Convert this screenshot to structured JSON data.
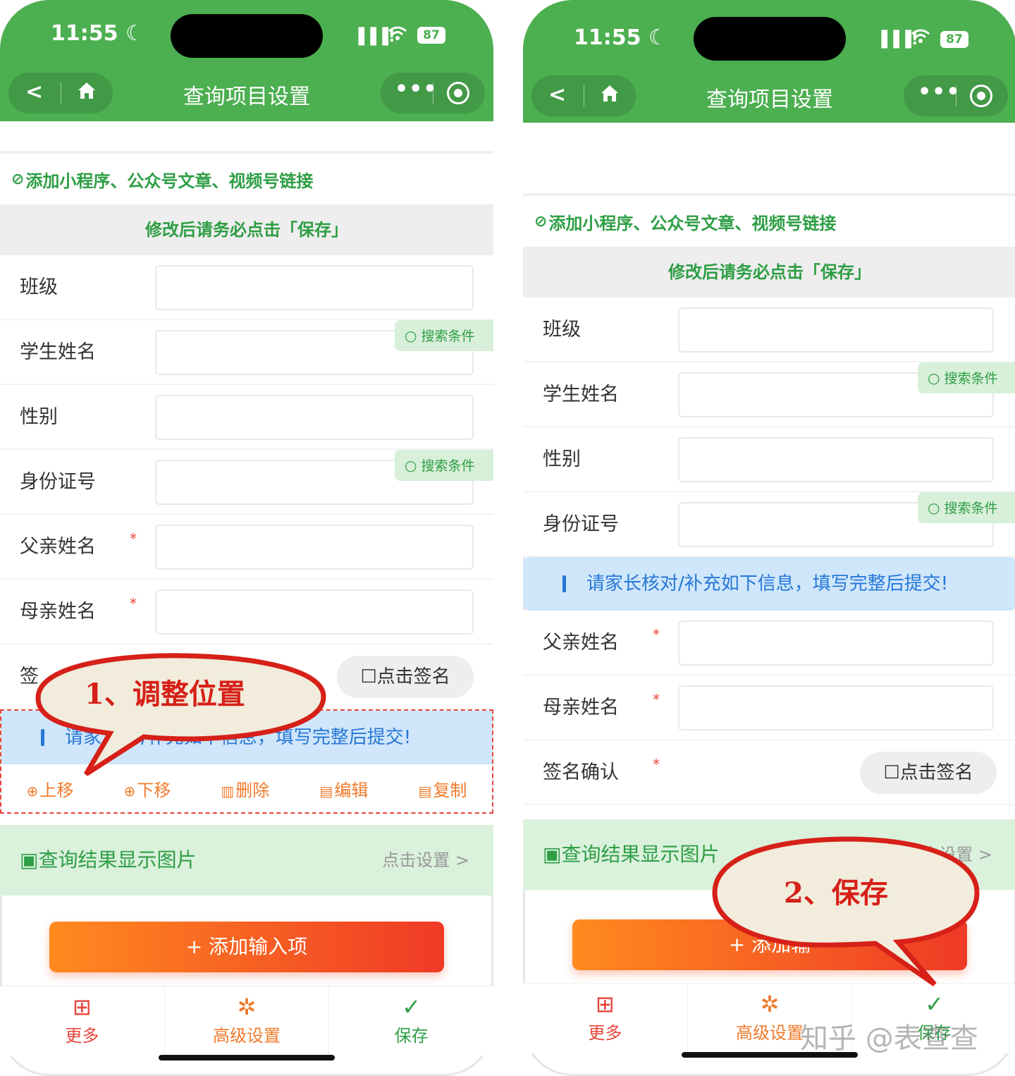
{
  "status_bar": {
    "time": "11:55 ☾",
    "battery": "87",
    "signal": "▐▐▐!",
    "wifi": "◠"
  },
  "nav": {
    "title": "查询项目设置",
    "back": "<",
    "more": "•••"
  },
  "colors": {
    "header_green": "#4caf50",
    "accent_green": "#2e9e45",
    "orange": "#f07a2b",
    "red": "#e8453c",
    "blue": "#2677d6"
  },
  "link_row": {
    "icon": "⊘",
    "label": "添加小程序、公众号文章、视频号链接"
  },
  "notice": "修改后请务必点击「保存」",
  "fields": {
    "class": "班级",
    "student_name": "学生姓名",
    "gender": "性别",
    "id_number": "身份证号",
    "father_name": "父亲姓名",
    "mother_name": "母亲姓名",
    "signature": "签名确认",
    "signature_left_visible": "签",
    "required_mark": "*"
  },
  "search_tag": {
    "icon": "○",
    "label": "搜索条件"
  },
  "sign_button": "☐点击签名",
  "banner": "请家长核对/补充如下信息，填写完整后提交!",
  "banner_left_visible": {
    "a": "请家",
    "b": "对/补充如下信息，填写完整后提交!"
  },
  "ops": [
    {
      "icon": "⊕",
      "label": "上移"
    },
    {
      "icon": "⊕",
      "label": "下移"
    },
    {
      "icon": "▥",
      "label": "删除"
    },
    {
      "icon": "▤",
      "label": "编辑"
    },
    {
      "icon": "▤",
      "label": "复制"
    }
  ],
  "result_image": {
    "icon": "▣",
    "label": "查询结果显示图片",
    "link": "点击设置 >",
    "link_partial": "击设置 >"
  },
  "add_button": "+ 添加输入项",
  "add_button_partial": "+ 添加输",
  "tabs": [
    {
      "icon": "⊞",
      "label": "更多",
      "color": "#e8453c"
    },
    {
      "icon": "✲",
      "label": "高级设置",
      "color": "#f07a2b"
    },
    {
      "icon": "✓",
      "label": "保存",
      "color": "#2e9e45"
    }
  ],
  "callouts": {
    "step1": "1、调整位置",
    "step2": "2、保存"
  },
  "watermark": "知乎 @表查查"
}
